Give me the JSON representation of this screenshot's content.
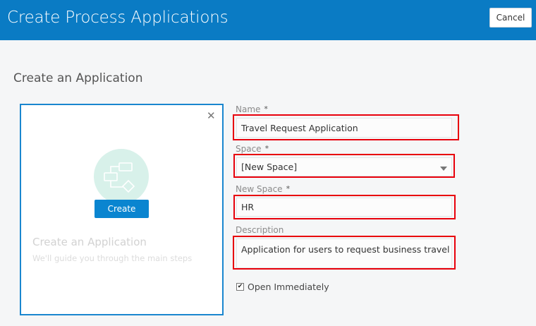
{
  "header": {
    "title": "Create Process Applications",
    "cancel_label": "Cancel"
  },
  "section_title": "Create an Application",
  "card": {
    "button_label": "Create",
    "title": "Create an Application",
    "subtitle": "We'll guide you through the main steps",
    "close_icon": "close-icon",
    "illustration_icon": "process-flow-icon"
  },
  "form": {
    "required_mark": "*",
    "name": {
      "label": "Name",
      "value": "Travel Request Application"
    },
    "space": {
      "label": "Space",
      "value": "[New Space]"
    },
    "new_space": {
      "label": "New Space",
      "value": "HR"
    },
    "description": {
      "label": "Description",
      "value": "Application for users to request business travel"
    },
    "open_immediately": {
      "label": "Open Immediately",
      "checked": true
    }
  },
  "colors": {
    "header": "#0a7bc4",
    "accent": "#0a85d0",
    "highlight": "#e8000b"
  }
}
